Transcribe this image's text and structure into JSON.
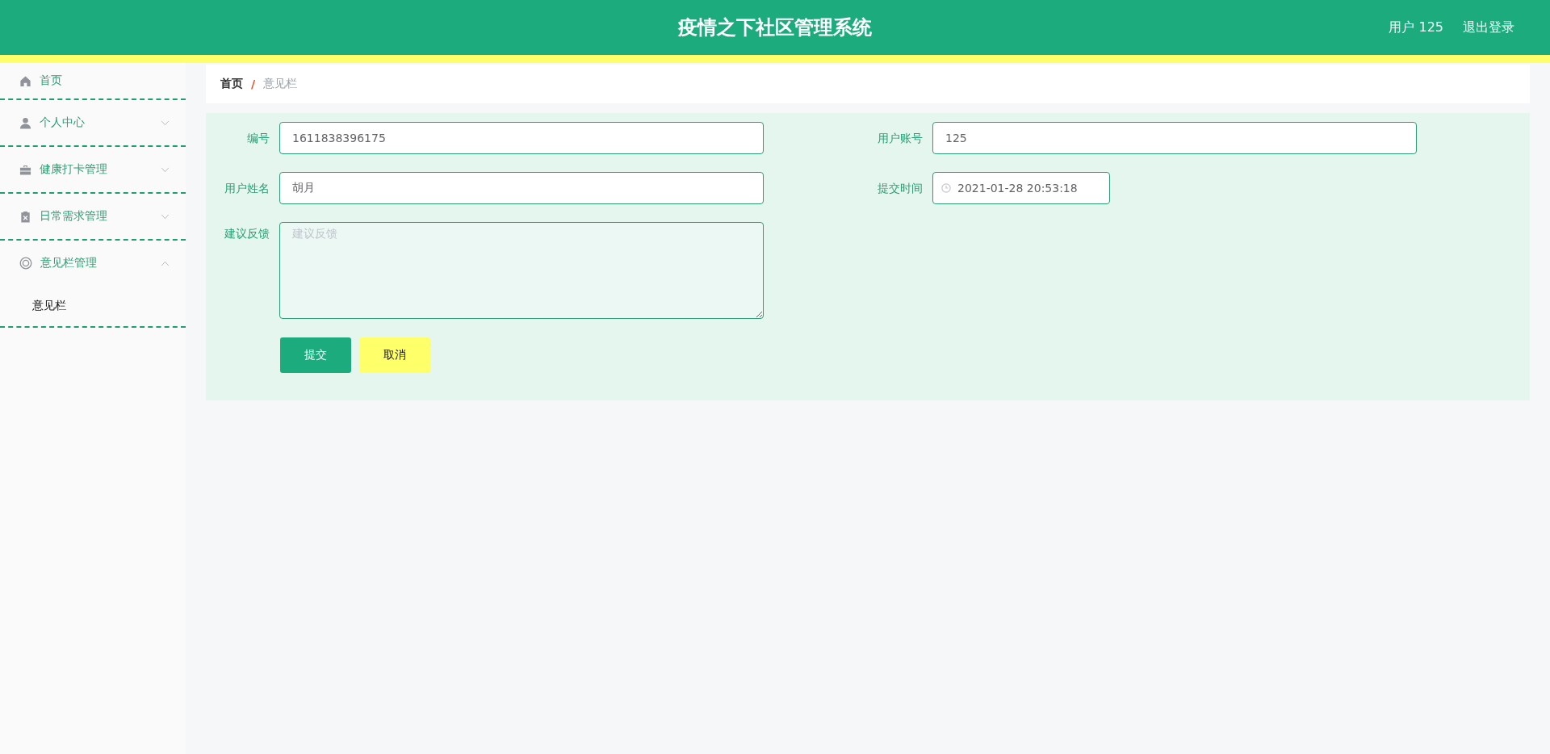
{
  "header": {
    "title": "疫情之下社区管理系统",
    "user": "用户 125",
    "logout": "退出登录"
  },
  "sidebar": {
    "items": [
      {
        "label": "首页",
        "kind": "link"
      },
      {
        "label": "个人中心",
        "kind": "menu",
        "expanded": false
      },
      {
        "label": "健康打卡管理",
        "kind": "menu",
        "expanded": false
      },
      {
        "label": "日常需求管理",
        "kind": "menu",
        "expanded": false
      },
      {
        "label": "意见栏管理",
        "kind": "menu",
        "expanded": true,
        "children": [
          {
            "label": "意见栏"
          }
        ]
      }
    ]
  },
  "breadcrumb": {
    "items": [
      "首页",
      "意见栏"
    ],
    "separator": "/"
  },
  "form": {
    "fields": [
      {
        "label": "编号",
        "value": "1611838396175",
        "kind": "text"
      },
      {
        "label": "用户账号",
        "value": "125",
        "kind": "text"
      },
      {
        "label": "用户姓名",
        "value": "胡月",
        "kind": "text"
      },
      {
        "label": "提交时间",
        "value": "2021-01-28 20:53:18",
        "kind": "datetime"
      },
      {
        "label": "建议反馈",
        "placeholder": "建议反馈",
        "kind": "textarea"
      }
    ],
    "buttons": [
      {
        "label": "提交",
        "kind": "primary"
      },
      {
        "label": "取消",
        "kind": "secondary"
      }
    ]
  }
}
